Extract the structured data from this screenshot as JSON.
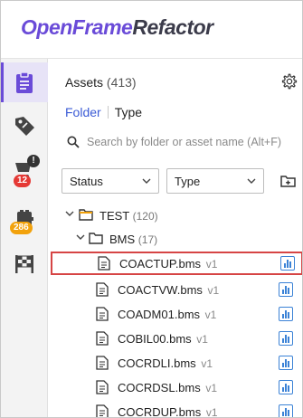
{
  "app": {
    "title_part1": "OpenFrame",
    "title_part2": "Refactor"
  },
  "rail": {
    "badges": {
      "cart": "12",
      "storage": "286",
      "cart_alert": "!"
    }
  },
  "panel": {
    "title": "Assets",
    "count": "(413)",
    "tabs": [
      {
        "label": "Folder",
        "active": true
      },
      {
        "label": "Type",
        "active": false
      }
    ],
    "search_placeholder": "Search by folder or asset name (Alt+F)",
    "filters": {
      "status": "Status",
      "type": "Type"
    }
  },
  "tree": {
    "root": {
      "name": "TEST",
      "count": "(120)"
    },
    "sub": {
      "name": "BMS",
      "count": "(17)"
    },
    "files": [
      {
        "name": "COACTUP.bms",
        "ver": "v1",
        "selected": true
      },
      {
        "name": "COACTVW.bms",
        "ver": "v1",
        "selected": false
      },
      {
        "name": "COADM01.bms",
        "ver": "v1",
        "selected": false
      },
      {
        "name": "COBIL00.bms",
        "ver": "v1",
        "selected": false
      },
      {
        "name": "COCRDLI.bms",
        "ver": "v1",
        "selected": false
      },
      {
        "name": "COCRDSL.bms",
        "ver": "v1",
        "selected": false
      },
      {
        "name": "COCRDUP.bms",
        "ver": "v1",
        "selected": false
      }
    ]
  },
  "colors": {
    "accent": "#6a4bd8",
    "link": "#3b5bd6",
    "selection": "#d64545",
    "chart": "#3b82d6"
  }
}
